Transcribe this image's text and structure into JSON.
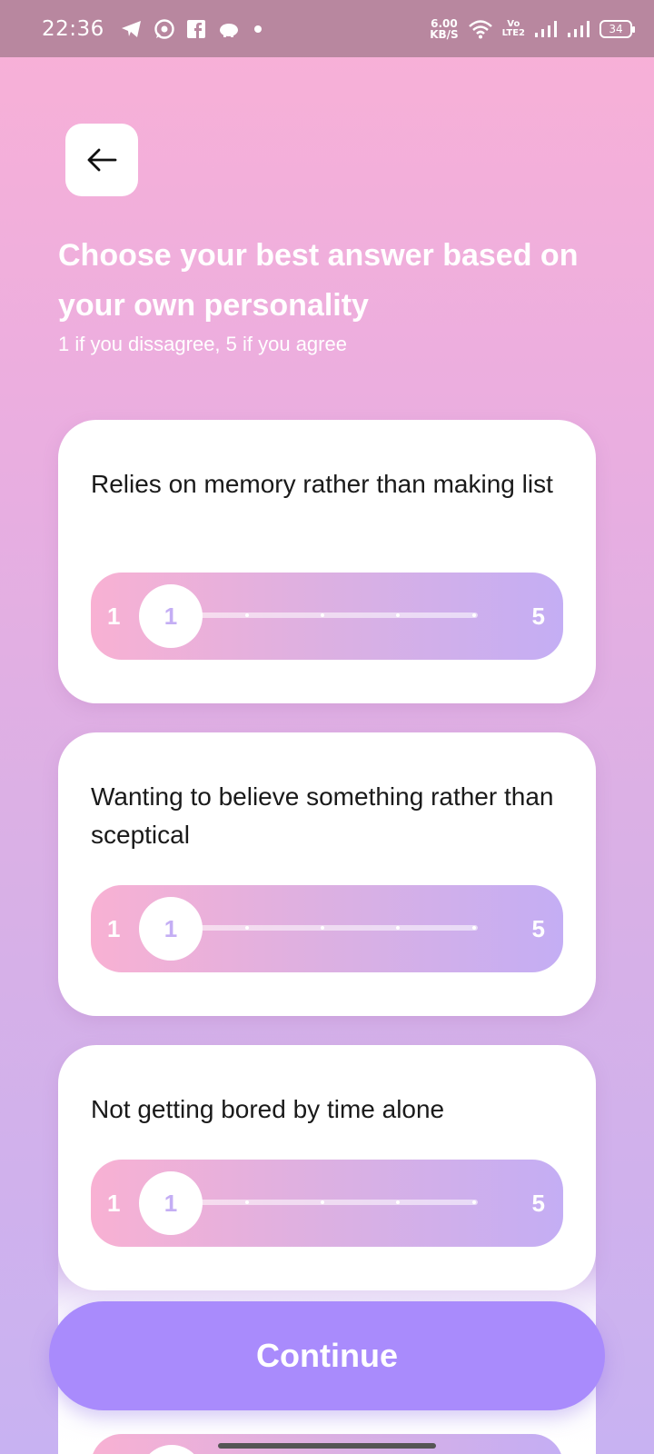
{
  "status_bar": {
    "time": "22:36",
    "net_speed_value": "6.00",
    "net_speed_unit": "KB/S",
    "volte_top": "Vo",
    "volte_bottom": "LTE2",
    "battery": "34"
  },
  "header": {
    "back_icon": "arrow-left-icon",
    "title": "Choose your best answer based on your own personality",
    "subtitle": "1 if you dissagree, 5 if you agree"
  },
  "questions": [
    {
      "text": "Relies on memory rather than making list",
      "min_label": "1",
      "max_label": "5",
      "value": "1"
    },
    {
      "text": "Wanting to believe something rather than sceptical",
      "min_label": "1",
      "max_label": "5",
      "value": "1"
    },
    {
      "text": "Not getting bored by time alone",
      "min_label": "1",
      "max_label": "5",
      "value": "1"
    }
  ],
  "footer": {
    "continue_label": "Continue"
  },
  "colors": {
    "accent": "#a98bfc",
    "status_bar": "#b8879f",
    "slider_start": "#f8b1d3",
    "slider_end": "#c4aef4"
  }
}
